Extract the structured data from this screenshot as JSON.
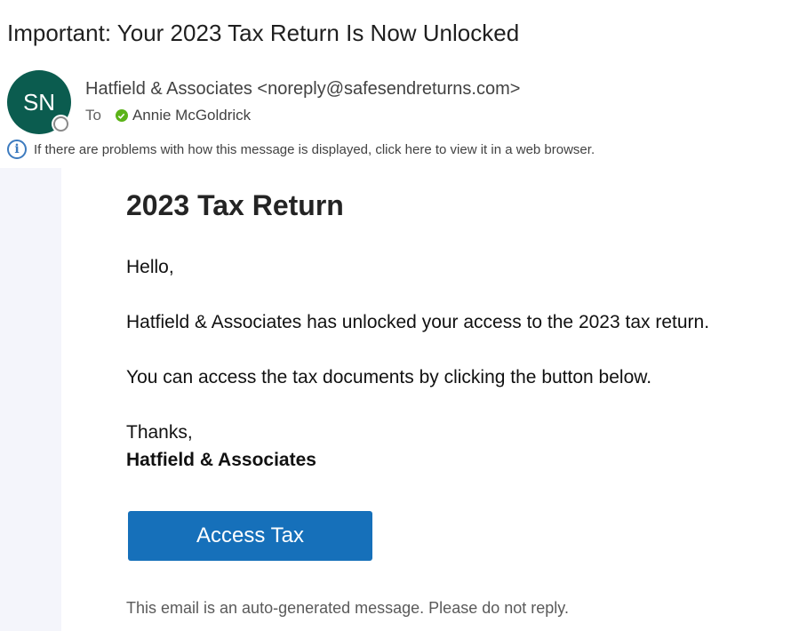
{
  "message": {
    "subject": "Important: Your 2023 Tax Return Is Now Unlocked",
    "avatar_initials": "SN",
    "sender": "Hatfield & Associates <noreply@safesendreturns.com>",
    "to_label": "To",
    "recipient": "Annie McGoldrick",
    "info_notice": "If there are problems with how this message is displayed, click here to view it in a web browser."
  },
  "email_body": {
    "heading": "2023 Tax Return",
    "greeting": "Hello,",
    "paragraph1": "Hatfield & Associates has unlocked your access to the 2023 tax return.",
    "paragraph2": "You can access the tax documents by clicking the button below.",
    "signoff": "Thanks,",
    "signature": "Hatfield & Associates",
    "button_label": "Access Tax",
    "footer_note": "This email is an auto-generated message. Please do not reply."
  },
  "colors": {
    "avatar_bg": "#0b5c4f",
    "button_bg": "#1670ba",
    "presence_check": "#5bb318",
    "info_icon": "#3d7bbf",
    "left_panel_bg": "#f4f5fb"
  },
  "icons": {
    "presence": "presence-status-icon",
    "recipient_status": "check-circle-icon",
    "info": "info-icon"
  }
}
